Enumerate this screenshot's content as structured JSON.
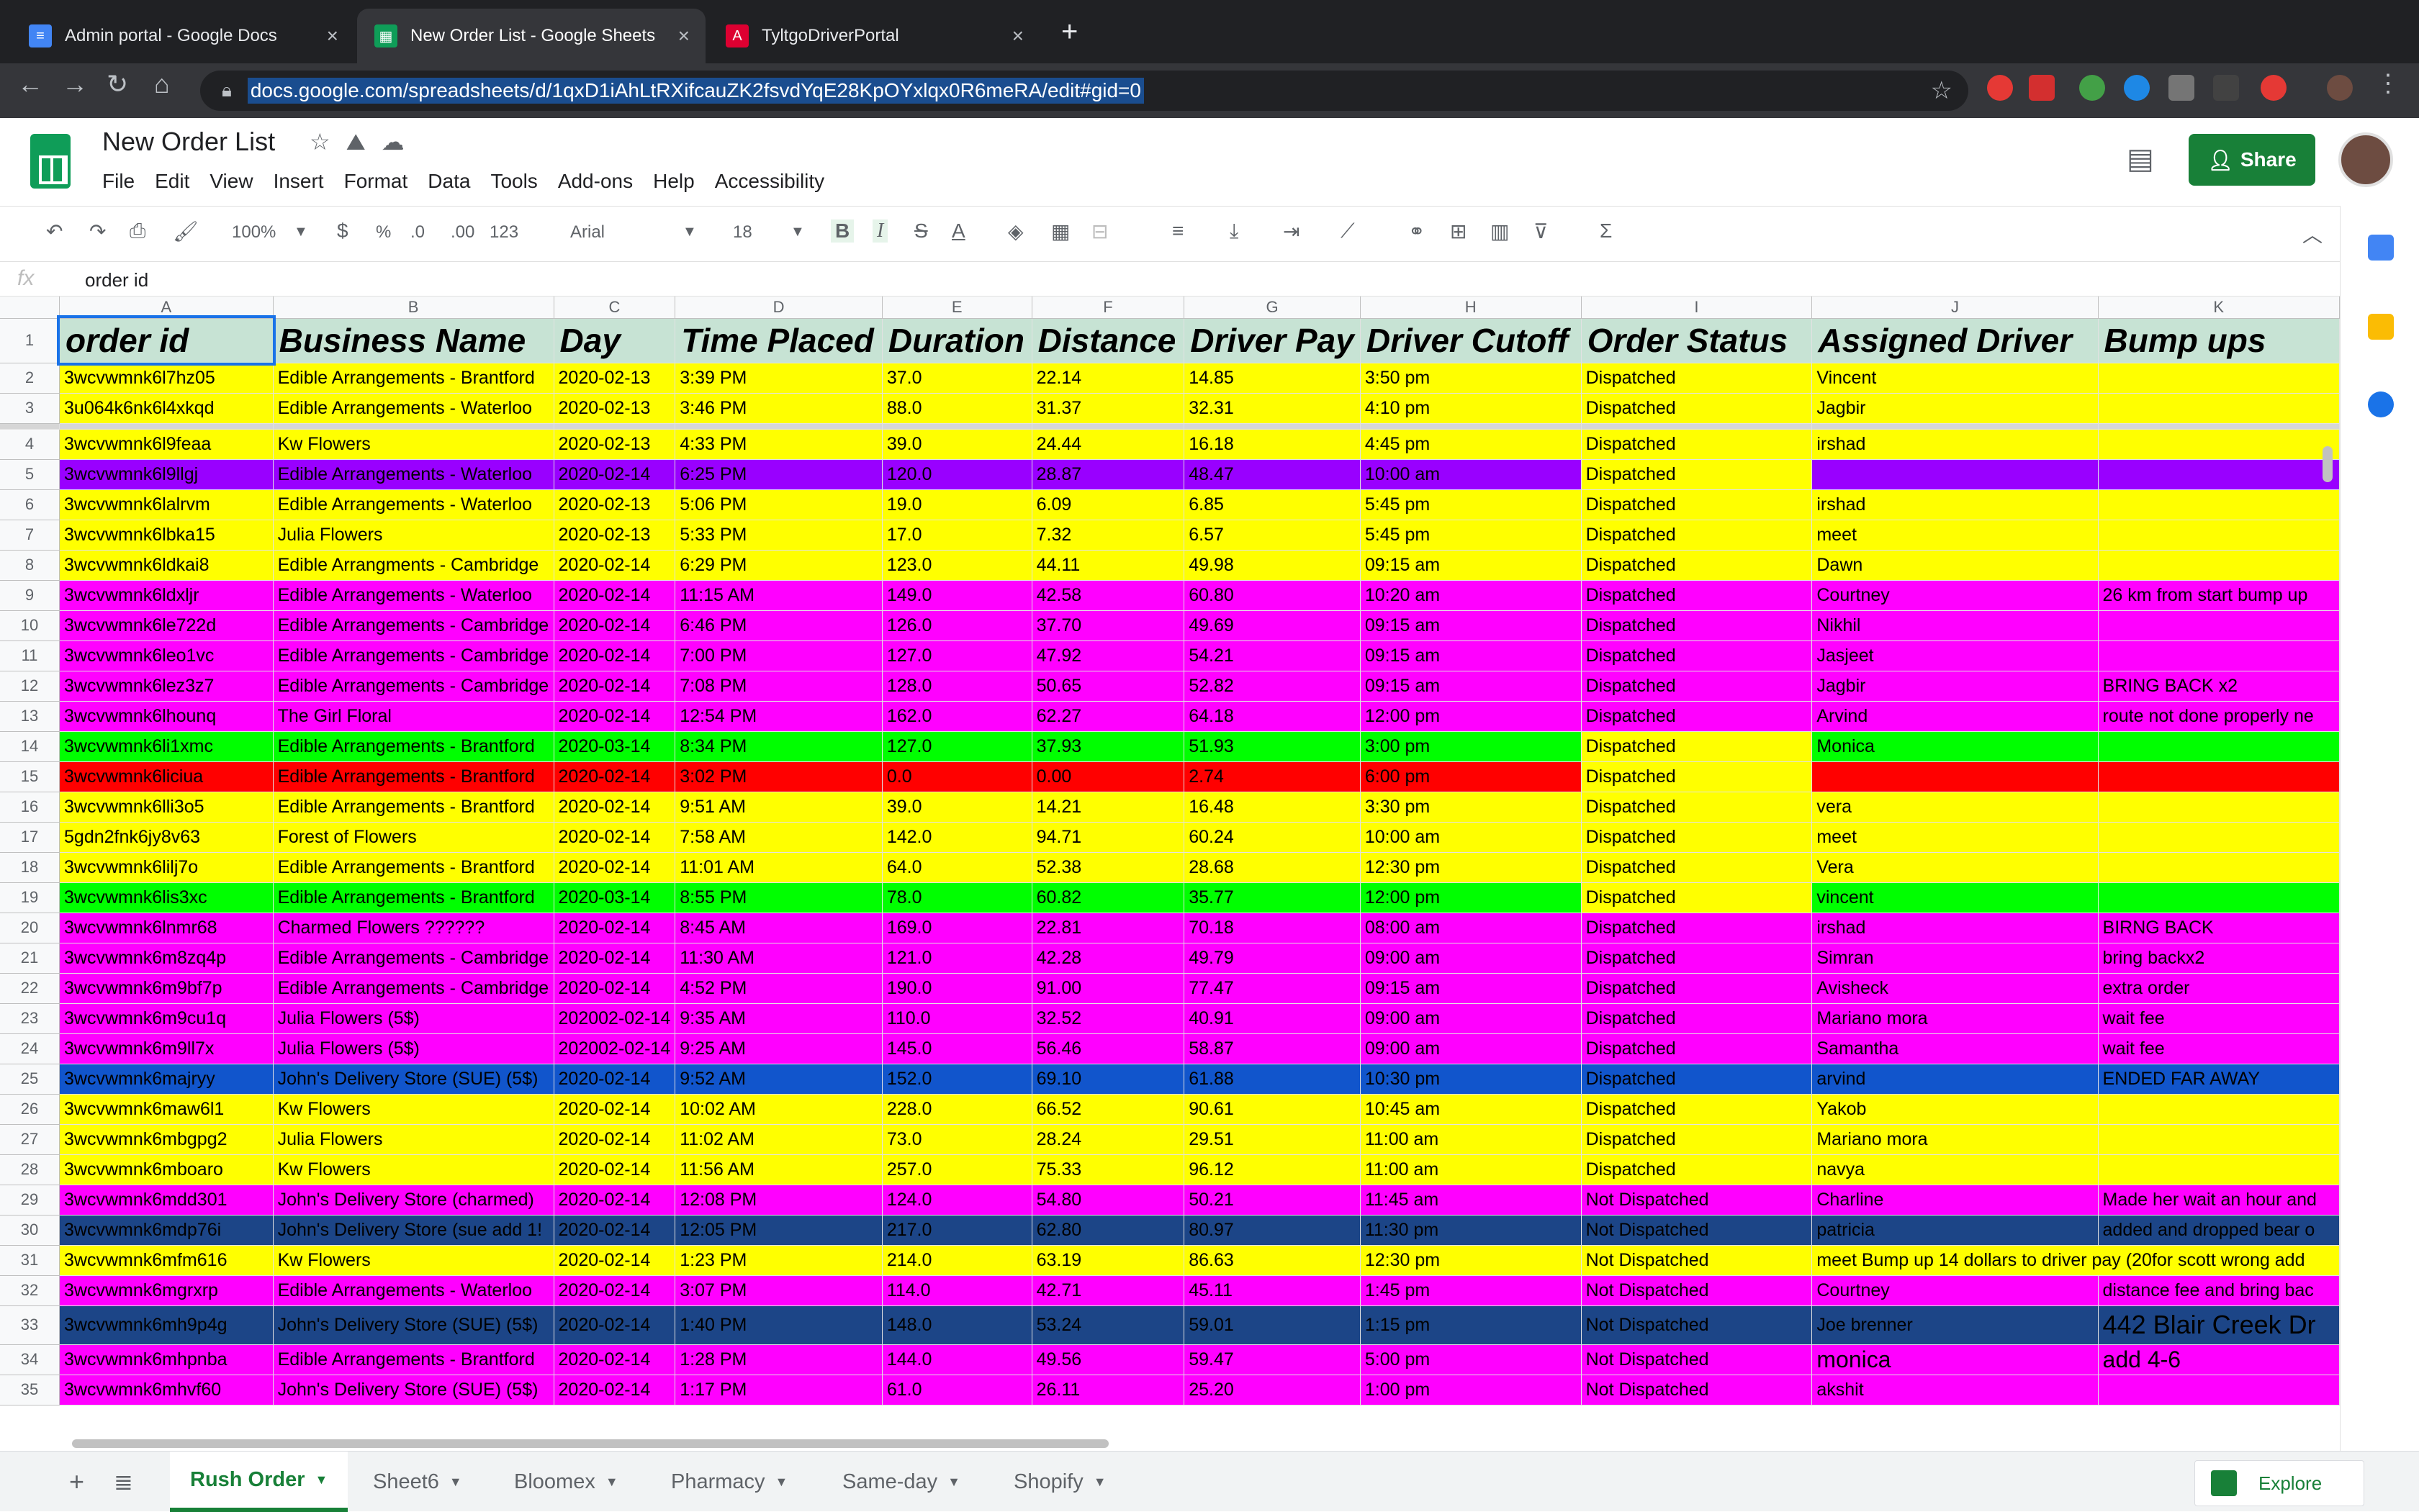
{
  "browser": {
    "tabs": [
      {
        "title": "Admin portal - Google Docs",
        "color": "#4285f4",
        "icon": "docs-icon"
      },
      {
        "title": "New Order List - Google Sheets",
        "color": "#0f9d58",
        "icon": "sheets-icon"
      },
      {
        "title": "TyltgoDriverPortal",
        "color": "#dd0031",
        "icon": "angular-icon"
      }
    ],
    "url": "docs.google.com/spreadsheets/d/1qxD1iAhLtRXifcauZK2fsvdYqE28KpOYxlqx0R6meRA/edit#gid=0"
  },
  "doc": {
    "title": "New Order List",
    "menu": [
      "File",
      "Edit",
      "View",
      "Insert",
      "Format",
      "Data",
      "Tools",
      "Add-ons",
      "Help",
      "Accessibility"
    ],
    "share_label": "Share"
  },
  "toolbar": {
    "zoom": "100%",
    "currency": "$",
    "percent": "%",
    "dec_less": ".0",
    "dec_more": ".00",
    "format_more": "123",
    "font": "Arial",
    "size": "18"
  },
  "formula": {
    "fx": "fx",
    "value": "order id"
  },
  "grid": {
    "columns": [
      "A",
      "B",
      "C",
      "D",
      "E",
      "F",
      "G",
      "H",
      "I",
      "J",
      "K"
    ],
    "headers": [
      "order id",
      "Business Name",
      "Day",
      "Time Placed",
      "Duration",
      "Distance",
      "Driver Pay",
      "Driver Cutoff",
      "Order Status",
      "Assigned Driver",
      "Bump ups"
    ],
    "colors": {
      "yellow": "#ffff00",
      "purple": "#9900ff",
      "magenta": "#ff00ff",
      "green": "#00ff00",
      "red": "#ff0000",
      "blue": "#1155cc",
      "navy": "#1c4587",
      "header": "#c7e3d4"
    },
    "rows": [
      {
        "n": "2",
        "bg": "yellow",
        "cells": [
          "3wcvwmnk6l7hz05",
          "Edible Arrangements - Brantford",
          "2020-02-13",
          "3:39 PM",
          "37.0",
          "22.14",
          "14.85",
          "3:50 pm",
          "Dispatched",
          "Vincent",
          ""
        ]
      },
      {
        "n": "3",
        "bg": "yellow",
        "cells": [
          "3u064k6nk6l4xkqd",
          "Edible Arrangements - Waterloo",
          "2020-02-13",
          "3:46 PM",
          "88.0",
          "31.37",
          "32.31",
          "4:10 pm",
          "Dispatched",
          "Jagbir",
          ""
        ]
      },
      {
        "n": "4",
        "bg": "yellow",
        "cells": [
          "3wcvwmnk6l9feaa",
          "Kw Flowers",
          "2020-02-13",
          "4:33 PM",
          "39.0",
          "24.44",
          "16.18",
          "4:45 pm",
          "Dispatched",
          "irshad",
          ""
        ]
      },
      {
        "n": "5",
        "bg": "purple",
        "cells": [
          "3wcvwmnk6l9llgj",
          "Edible Arrangements - Waterloo",
          "2020-02-14",
          "6:25 PM",
          "120.0",
          "28.87",
          "48.47",
          "10:00 am",
          "Dispatched",
          "",
          ""
        ]
      },
      {
        "n": "6",
        "bg": "yellow",
        "cells": [
          "3wcvwmnk6lalrvm",
          "Edible Arrangements - Waterloo",
          "2020-02-13",
          "5:06 PM",
          "19.0",
          "6.09",
          "6.85",
          "5:45 pm",
          "Dispatched",
          "irshad",
          ""
        ]
      },
      {
        "n": "7",
        "bg": "yellow",
        "cells": [
          "3wcvwmnk6lbka15",
          "Julia Flowers",
          "2020-02-13",
          "5:33 PM",
          "17.0",
          "7.32",
          "6.57",
          "5:45 pm",
          "Dispatched",
          "meet",
          ""
        ]
      },
      {
        "n": "8",
        "bg": "yellow",
        "cells": [
          "3wcvwmnk6ldkai8",
          "Edible Arrangments - Cambridge",
          "2020-02-14",
          "6:29 PM",
          "123.0",
          "44.11",
          "49.98",
          "09:15 am",
          "Dispatched",
          "Dawn",
          ""
        ]
      },
      {
        "n": "9",
        "bg": "magenta",
        "cells": [
          "3wcvwmnk6ldxljr",
          "Edible Arrangements - Waterloo",
          "2020-02-14",
          "11:15 AM",
          "149.0",
          "42.58",
          "60.80",
          "10:20 am",
          "Dispatched",
          "Courtney",
          "26 km from start bump up"
        ]
      },
      {
        "n": "10",
        "bg": "magenta",
        "cells": [
          "3wcvwmnk6le722d",
          "Edible Arrangements - Cambridge",
          "2020-02-14",
          "6:46 PM",
          "126.0",
          "37.70",
          "49.69",
          "09:15 am",
          "Dispatched",
          "Nikhil",
          ""
        ]
      },
      {
        "n": "11",
        "bg": "magenta",
        "cells": [
          "3wcvwmnk6leo1vc",
          "Edible Arrangements - Cambridge",
          "2020-02-14",
          "7:00 PM",
          "127.0",
          "47.92",
          "54.21",
          "09:15 am",
          "Dispatched",
          "Jasjeet",
          ""
        ]
      },
      {
        "n": "12",
        "bg": "magenta",
        "cells": [
          "3wcvwmnk6lez3z7",
          "Edible Arrangements - Cambridge",
          "2020-02-14",
          "7:08 PM",
          "128.0",
          "50.65",
          "52.82",
          "09:15 am",
          "Dispatched",
          "Jagbir",
          "BRING BACK x2"
        ]
      },
      {
        "n": "13",
        "bg": "magenta",
        "cells": [
          "3wcvwmnk6lhounq",
          "The Girl Floral",
          "2020-02-14",
          "12:54 PM",
          "162.0",
          "62.27",
          "64.18",
          "12:00 pm",
          "Dispatched",
          "Arvind",
          "route not done properly ne"
        ]
      },
      {
        "n": "14",
        "bg": "green",
        "cells": [
          "3wcvwmnk6li1xmc",
          "Edible Arrangements - Brantford",
          "2020-03-14",
          "8:34 PM",
          "127.0",
          "37.93",
          "51.93",
          "3:00 pm",
          "Dispatched",
          "Monica",
          ""
        ]
      },
      {
        "n": "15",
        "bg": "red",
        "cells": [
          "3wcvwmnk6liciua",
          "Edible Arrangements - Brantford",
          "2020-02-14",
          "3:02 PM",
          "0.0",
          "0.00",
          "2.74",
          "6:00 pm",
          "Dispatched",
          "",
          ""
        ]
      },
      {
        "n": "16",
        "bg": "yellow",
        "cells": [
          "3wcvwmnk6lli3o5",
          "Edible Arrangements - Brantford",
          "2020-02-14",
          "9:51 AM",
          "39.0",
          "14.21",
          "16.48",
          "3:30 pm",
          "Dispatched",
          "vera",
          ""
        ]
      },
      {
        "n": "17",
        "bg": "yellow",
        "cells": [
          "5gdn2fnk6jy8v63",
          "Forest of Flowers",
          "2020-02-14",
          "7:58 AM",
          "142.0",
          "94.71",
          "60.24",
          "10:00 am",
          "Dispatched",
          "meet",
          ""
        ]
      },
      {
        "n": "18",
        "bg": "yellow",
        "cells": [
          "3wcvwmnk6lilj7o",
          "Edible Arrangements - Brantford",
          "2020-02-14",
          "11:01 AM",
          "64.0",
          "52.38",
          "28.68",
          "12:30 pm",
          "Dispatched",
          "Vera",
          ""
        ]
      },
      {
        "n": "19",
        "bg": "green",
        "cells": [
          "3wcvwmnk6lis3xc",
          "Edible Arrangements - Brantford",
          "2020-03-14",
          "8:55 PM",
          "78.0",
          "60.82",
          "35.77",
          "12:00 pm",
          "Dispatched",
          "vincent",
          ""
        ]
      },
      {
        "n": "20",
        "bg": "magenta",
        "cells": [
          "3wcvwmnk6lnmr68",
          "Charmed Flowers ??????",
          "2020-02-14",
          "8:45 AM",
          "169.0",
          "22.81",
          "70.18",
          "08:00 am",
          "Dispatched",
          "irshad",
          " BIRNG BACK"
        ]
      },
      {
        "n": "21",
        "bg": "magenta",
        "cells": [
          "3wcvwmnk6m8zq4p",
          "Edible Arrangements - Cambridge",
          "2020-02-14",
          "11:30 AM",
          "121.0",
          "42.28",
          "49.79",
          "09:00 am",
          "Dispatched",
          "Simran",
          "bring backx2"
        ]
      },
      {
        "n": "22",
        "bg": "magenta",
        "cells": [
          "3wcvwmnk6m9bf7p",
          "Edible Arrangements - Cambridge",
          "2020-02-14",
          "4:52 PM",
          "190.0",
          "91.00",
          "77.47",
          "09:15 am",
          "Dispatched",
          "Avisheck",
          "extra order"
        ]
      },
      {
        "n": "23",
        "bg": "magenta",
        "cells": [
          "3wcvwmnk6m9cu1q",
          "Julia Flowers (5$)",
          "202002-02-14",
          "9:35 AM",
          "110.0",
          "32.52",
          "40.91",
          "09:00 am",
          "Dispatched",
          "Mariano mora",
          "wait fee"
        ]
      },
      {
        "n": "24",
        "bg": "magenta",
        "cells": [
          "3wcvwmnk6m9ll7x",
          "Julia Flowers (5$)",
          "202002-02-14",
          "9:25 AM",
          "145.0",
          "56.46",
          "58.87",
          "09:00 am",
          "Dispatched",
          "Samantha",
          "wait fee"
        ]
      },
      {
        "n": "25",
        "bg": "blue",
        "cells": [
          "3wcvwmnk6majryy",
          "John's Delivery Store (SUE) (5$)",
          "2020-02-14",
          "9:52 AM",
          "152.0",
          "69.10",
          "61.88",
          "10:30 pm",
          "Dispatched",
          "arvind",
          "ENDED FAR AWAY"
        ]
      },
      {
        "n": "26",
        "bg": "yellow",
        "cells": [
          "3wcvwmnk6maw6l1",
          "Kw Flowers",
          "2020-02-14",
          "10:02 AM",
          "228.0",
          "66.52",
          "90.61",
          "10:45 am",
          "Dispatched",
          "Yakob",
          ""
        ]
      },
      {
        "n": "27",
        "bg": "yellow",
        "cells": [
          "3wcvwmnk6mbgpg2",
          "Julia Flowers",
          "2020-02-14",
          "11:02 AM",
          "73.0",
          "28.24",
          "29.51",
          "11:00 am",
          "Dispatched",
          "Mariano mora",
          ""
        ]
      },
      {
        "n": "28",
        "bg": "yellow",
        "cells": [
          "3wcvwmnk6mboaro",
          "Kw Flowers",
          "2020-02-14",
          "11:56 AM",
          "257.0",
          "75.33",
          "96.12",
          "11:00 am",
          "Dispatched",
          "navya",
          ""
        ]
      },
      {
        "n": "29",
        "bg": "magenta",
        "cells": [
          "3wcvwmnk6mdd301",
          "John's Delivery Store (charmed)",
          "2020-02-14",
          "12:08 PM",
          "124.0",
          "54.80",
          "50.21",
          "11:45 am",
          "Not Dispatched",
          "Charline",
          "Made her wait an hour and"
        ]
      },
      {
        "n": "30",
        "bg": "navy",
        "cells": [
          "3wcvwmnk6mdp76i",
          "John's Delivery Store (sue add 1!",
          "2020-02-14",
          "12:05 PM",
          "217.0",
          "62.80",
          "80.97",
          "11:30 pm",
          "Not Dispatched",
          "patricia",
          "added and dropped bear o"
        ]
      },
      {
        "n": "31",
        "bg": "yellow",
        "cells": [
          "3wcvwmnk6mfm616",
          "Kw Flowers",
          "2020-02-14",
          "1:23 PM",
          "214.0",
          "63.19",
          "86.63",
          "12:30 pm",
          "Not Dispatched",
          "meet Bump up 14 dollars to driver pay (20for scott wrong add",
          ""
        ]
      },
      {
        "n": "32",
        "bg": "magenta",
        "cells": [
          "3wcvwmnk6mgrxrp",
          "Edible Arrangements - Waterloo",
          "2020-02-14",
          "3:07 PM",
          "114.0",
          "42.71",
          "45.11",
          "1:45 pm",
          "Not Dispatched",
          "Courtney",
          "distance fee and bring bac"
        ]
      },
      {
        "n": "33",
        "bg": "navy",
        "cells": [
          "3wcvwmnk6mh9p4g",
          "John's Delivery Store (SUE) (5$)",
          "2020-02-14",
          "1:40 PM",
          "148.0",
          "53.24",
          "59.01",
          "1:15 pm",
          "Not Dispatched",
          "Joe brenner",
          "442 Blair Creek Dr"
        ]
      },
      {
        "n": "34",
        "bg": "magenta",
        "cells": [
          "3wcvwmnk6mhpnba",
          "Edible Arrangements - Brantford",
          "2020-02-14",
          "1:28 PM",
          "144.0",
          "49.56",
          "59.47",
          "5:00 pm",
          "Not Dispatched",
          "monica",
          "add 4-6"
        ]
      },
      {
        "n": "35",
        "bg": "magenta",
        "cells": [
          "3wcvwmnk6mhvf60",
          "John's Delivery Store (SUE) (5$)",
          "2020-02-14",
          "1:17 PM",
          "61.0",
          "26.11",
          "25.20",
          "1:00 pm",
          "Not Dispatched",
          "akshit",
          ""
        ]
      }
    ]
  },
  "sheets": [
    "Rush Order",
    "Sheet6",
    "Bloomex",
    "Pharmacy",
    "Same-day",
    "Shopify"
  ],
  "explore_label": "Explore"
}
